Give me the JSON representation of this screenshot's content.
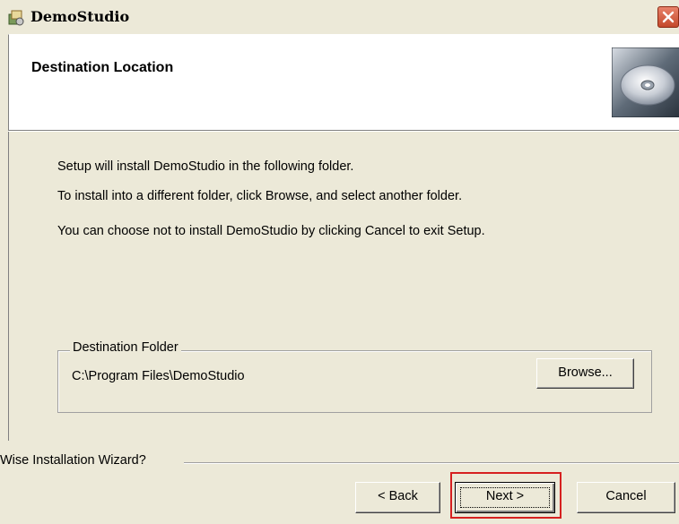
{
  "window": {
    "title": "DemoStudio",
    "close_icon": "close-icon"
  },
  "header": {
    "title": "Destination Location",
    "art_icon": "cd-disc-icon"
  },
  "body": {
    "lines": [
      "Setup will install DemoStudio in the following folder.",
      "To install into a different folder, click Browse, and select another folder.",
      "You can choose not to install DemoStudio by clicking Cancel to exit Setup."
    ]
  },
  "destination": {
    "legend": "Destination Folder",
    "path": "C:\\Program Files\\DemoStudio",
    "browse_label": "Browse..."
  },
  "footer": {
    "brand": "Wise Installation Wizard?",
    "back_label": "< Back",
    "next_label": "Next >",
    "cancel_label": "Cancel"
  },
  "colors": {
    "highlight": "#d62020",
    "close_button": "#c4492c",
    "background": "#ece9d8"
  }
}
